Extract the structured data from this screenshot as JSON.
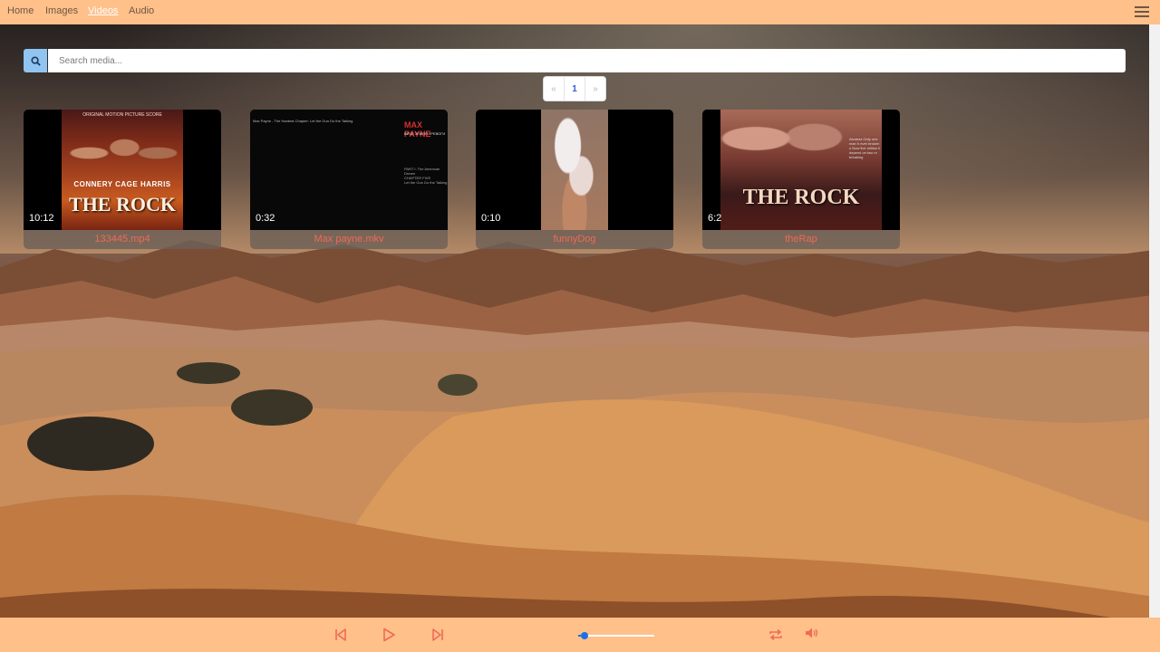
{
  "nav": {
    "links": [
      {
        "label": "Home"
      },
      {
        "label": "Images"
      },
      {
        "label": "Videos",
        "active": true
      },
      {
        "label": "Audio"
      }
    ]
  },
  "search": {
    "placeholder": "Search media..."
  },
  "pagination": {
    "prev": "«",
    "current": "1",
    "next": "»"
  },
  "videos": [
    {
      "title": "133445.mp4",
      "duration": "10:12",
      "poster": {
        "top_text": "ORIGINAL MOTION PICTURE SCORE",
        "names": "CONNERY CAGE HARRIS",
        "big_title": "THE ROCK"
      }
    },
    {
      "title": "Max payne.mkv",
      "duration": "0:32",
      "poster": {
        "header": "Max Payne - The Hardest Chapter: Let the Gun Do the Talking",
        "logo": "MAX PAYNE",
        "subtitle": "ВЕЧЕ ЗЕМЛЯ ТРЕВОГИ",
        "chapter": "PART I: The American Dream",
        "chapter2": "CHAPTER FIVE",
        "chapter3": "Let the Gun Do the Talking"
      }
    },
    {
      "title": "funnyDog",
      "duration": "0:10"
    },
    {
      "title": "theRap",
      "duration": "6:2",
      "poster": {
        "credits": "Alcatraz Only one man h ever broken o Now five million li depend on two m breaking",
        "big_title": "THE ROCK"
      }
    }
  ],
  "player": {
    "progress": 0.04,
    "accent_color": "#f06a55",
    "knob_color": "#1e6fe0",
    "controls": [
      "skip-previous-icon",
      "play-icon",
      "skip-next-icon",
      "repeat-icon",
      "volume-icon"
    ]
  }
}
